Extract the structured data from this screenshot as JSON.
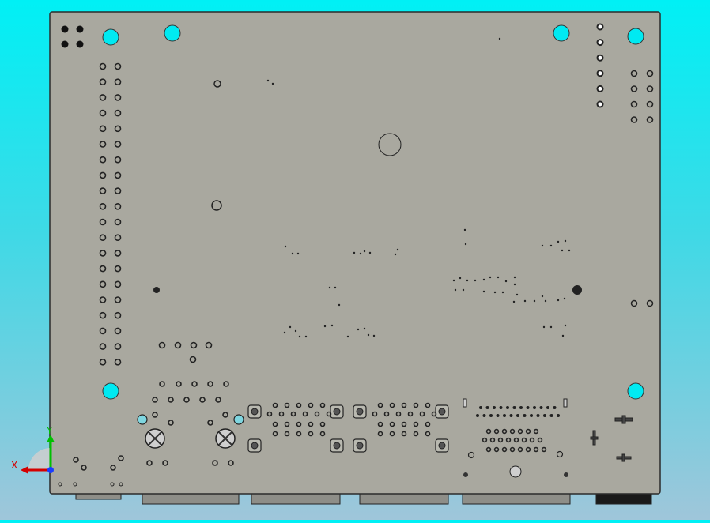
{
  "viewport": {
    "background_top": "#00f0f5",
    "background_bottom": "#9fc6da"
  },
  "board": {
    "fill": "#a9a89f",
    "stroke": "#2b2b2b",
    "mounting_hole_color": "#00eaf2"
  },
  "triad": {
    "x_label": "X",
    "y_label": "Y",
    "x_color": "#d40000",
    "y_color": "#00c000",
    "z_color": "#1a3cff"
  },
  "icons": {
    "triad": "coordinate-triad-icon",
    "hole": "mounting-hole-icon"
  }
}
